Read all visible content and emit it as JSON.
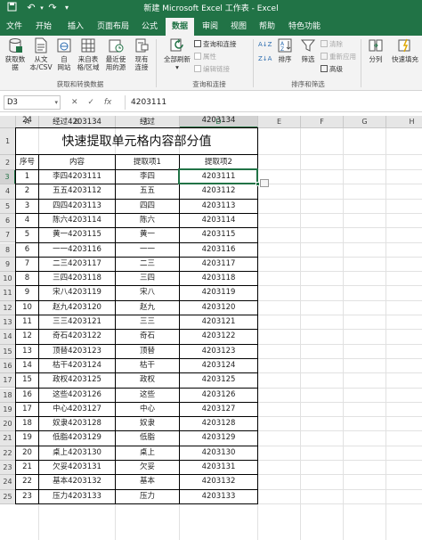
{
  "window": {
    "title": "新建 Microsoft Excel 工作表  -  Excel"
  },
  "tabs": [
    "文件",
    "开始",
    "插入",
    "页面布局",
    "公式",
    "数据",
    "审阅",
    "视图",
    "帮助",
    "特色功能"
  ],
  "active_tab": "数据",
  "ribbon": {
    "get_data": {
      "line1": "获取数",
      "line2": "据"
    },
    "from_csv": {
      "line1": "从文",
      "line2": "本/CSV"
    },
    "from_web": {
      "line1": "自",
      "line2": "网站"
    },
    "from_table": {
      "line1": "来自表",
      "line2": "格/区域"
    },
    "recent_sources": {
      "line1": "最近使",
      "line2": "用的源"
    },
    "existing_connections": {
      "line1": "现有",
      "line2": "连接"
    },
    "refresh_all": {
      "line1": "全部刷新"
    },
    "queries_connections": "查询和连接",
    "properties": "属性",
    "edit_links": "编辑链接",
    "sort": "排序",
    "filter": "筛选",
    "clear": "清除",
    "reapply": "重新应用",
    "advanced": "高级",
    "split": "分列",
    "flash_fill": "快速填充",
    "group_get_transform": "获取和转换数据",
    "group_queries": "查询和连接",
    "group_sort_filter": "排序和筛选"
  },
  "formula_bar": {
    "name_box": "D3",
    "cancel": "✕",
    "enter": "✓",
    "fx": "fx",
    "value": "4203111"
  },
  "columns": [
    "A",
    "B",
    "C",
    "D",
    "E",
    "F",
    "G",
    "H"
  ],
  "rows": [
    "1",
    "2",
    "3",
    "4",
    "5",
    "6",
    "7",
    "8",
    "9",
    "10",
    "11",
    "12",
    "13",
    "14",
    "15",
    "16",
    "17",
    "18",
    "19",
    "20",
    "21",
    "22",
    "23",
    "24",
    "25"
  ],
  "sheet": {
    "title": "快速提取单元格内容部分值",
    "headers": [
      "序号",
      "内容",
      "提取项1",
      "提取项2"
    ],
    "data": [
      [
        "1",
        "李四4203111",
        "李四",
        "4203111"
      ],
      [
        "2",
        "五五4203112",
        "五五",
        "4203112"
      ],
      [
        "3",
        "四四4203113",
        "四四",
        "4203113"
      ],
      [
        "4",
        "陈六4203114",
        "陈六",
        "4203114"
      ],
      [
        "5",
        "黄一4203115",
        "黄一",
        "4203115"
      ],
      [
        "6",
        "一一4203116",
        "一一",
        "4203116"
      ],
      [
        "7",
        "二三4203117",
        "二三",
        "4203117"
      ],
      [
        "8",
        "三四4203118",
        "三四",
        "4203118"
      ],
      [
        "9",
        "宋八4203119",
        "宋八",
        "4203119"
      ],
      [
        "10",
        "赵九4203120",
        "赵九",
        "4203120"
      ],
      [
        "11",
        "三三4203121",
        "三三",
        "4203121"
      ],
      [
        "12",
        "奇石4203122",
        "奇石",
        "4203122"
      ],
      [
        "13",
        "顶替4203123",
        "顶替",
        "4203123"
      ],
      [
        "14",
        "枯干4203124",
        "枯干",
        "4203124"
      ],
      [
        "15",
        "政权4203125",
        "政权",
        "4203125"
      ],
      [
        "16",
        "这些4203126",
        "这些",
        "4203126"
      ],
      [
        "17",
        "中心4203127",
        "中心",
        "4203127"
      ],
      [
        "18",
        "奴隶4203128",
        "奴隶",
        "4203128"
      ],
      [
        "19",
        "低脂4203129",
        "低脂",
        "4203129"
      ],
      [
        "20",
        "桌上4203130",
        "桌上",
        "4203130"
      ],
      [
        "21",
        "欠妥4203131",
        "欠妥",
        "4203131"
      ],
      [
        "22",
        "基本4203132",
        "基本",
        "4203132"
      ],
      [
        "23",
        "压力4203133",
        "压力",
        "4203133"
      ],
      [
        "24",
        "经过4203134",
        "经过",
        "4203134"
      ]
    ]
  },
  "colors": {
    "excel_green": "#217346",
    "ribbon_bg": "#f3f3f3",
    "header_bg": "#e6e6e6",
    "grid_line": "#e1e1e1"
  }
}
